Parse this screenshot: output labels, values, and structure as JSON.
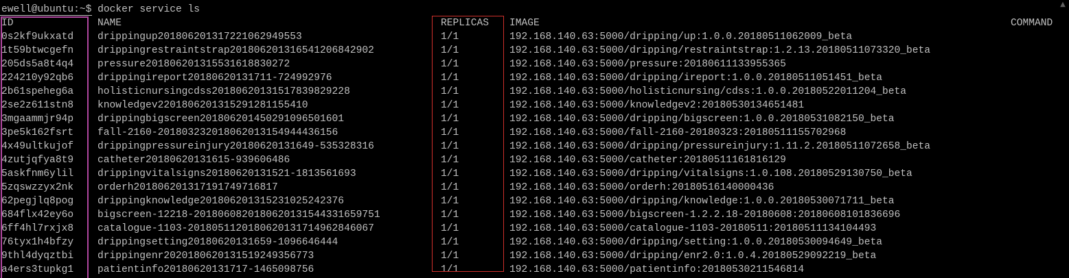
{
  "terminal": {
    "prompt": "ewell@ubuntu:~$ docker service ls",
    "text_color": "#c0c0c0",
    "background": "#000000",
    "highlight_id_color": "#b0479f",
    "highlight_replicas_color": "#d0302b",
    "scrollbar_arrow_icon": "up-arrow-icon",
    "scrollbar_arrow_glyph": "▲"
  },
  "headers": {
    "id": "ID",
    "name": "NAME",
    "replicas": "REPLICAS",
    "image": "IMAGE",
    "command": "COMMAND"
  },
  "rows": [
    {
      "id": "0s2kf9ukxatd",
      "name": "drippingup20180620131722106294955​3",
      "replicas": "1/1",
      "image": "192.168.140.63:5000/dripping/up:1.0.0.20180511062009_beta"
    },
    {
      "id": "1t59btwcgefn",
      "name": "drippingrestraintstrap20180620131654120684290​2",
      "replicas": "1/1",
      "image": "192.168.140.63:5000/dripping/restraintstrap:1.2.13.20180511073320_beta"
    },
    {
      "id": "205ds5a8t4q4",
      "name": "pressure20180620131553161883027​2",
      "replicas": "1/1",
      "image": "192.168.140.63:5000/pressure:20180611133955365"
    },
    {
      "id": "224210y92qb6",
      "name": "drippingireport20180620131711-724992976",
      "replicas": "1/1",
      "image": "192.168.140.63:5000/dripping/ireport:1.0.0.20180511051451_beta"
    },
    {
      "id": "2b61speheg6a",
      "name": "holisticnursingcdss20180620131517839829228",
      "replicas": "1/1",
      "image": "192.168.140.63:5000/holisticnursing/cdss:1.0.0.20180522011204_beta"
    },
    {
      "id": "2se2z611stn8",
      "name": "knowledgev220180620131529128115541​0",
      "replicas": "1/1",
      "image": "192.168.140.63:5000/knowledgev2:20180530134651481"
    },
    {
      "id": "3mgaammjr94p",
      "name": "drippingbigscreen20180620145029109650160​1",
      "replicas": "1/1",
      "image": "192.168.140.63:5000/dripping/bigscreen:1.0.0.20180531082150_beta"
    },
    {
      "id": "3pe5k162fsrt",
      "name": "fall-2160-20180323201806201315494443615​6",
      "replicas": "1/1",
      "image": "192.168.140.63:5000/fall-2160-20180323:20180511155702968"
    },
    {
      "id": "4x49ultkujof",
      "name": "drippingpressureinjury20180620131649-535328316",
      "replicas": "1/1",
      "image": "192.168.140.63:5000/dripping/pressureinjury:1.11.2.20180511072658_beta"
    },
    {
      "id": "4zutjqfya8t9",
      "name": "catheter20180620131615-939606486",
      "replicas": "1/1",
      "image": "192.168.140.63:5000/catheter:20180511161816129"
    },
    {
      "id": "5askfnm6ylil",
      "name": "drippingvitalsigns20180620131521-1813561693",
      "replicas": "1/1",
      "image": "192.168.140.63:5000/dripping/vitalsigns:1.0.108.20180529130750_beta"
    },
    {
      "id": "5zqswzzyx2nk",
      "name": "orderh20180620131719174971681​7",
      "replicas": "1/1",
      "image": "192.168.140.63:5000/orderh:20180516140000436"
    },
    {
      "id": "62pegjlq8pog",
      "name": "drippingknowledge20180620131523102524237​6",
      "replicas": "1/1",
      "image": "192.168.140.63:5000/dripping/knowledge:1.0.0.20180530071711_beta"
    },
    {
      "id": "684flx42ey6o",
      "name": "bigscreen-12218-2018060820180620131544331659751",
      "replicas": "1/1",
      "image": "192.168.140.63:5000/bigscreen-1.2.2.18-20180608:20180608101836696"
    },
    {
      "id": "6ff4hl7rxjx8",
      "name": "catalogue-1103-2018051120180620131714962846067",
      "replicas": "1/1",
      "image": "192.168.140.63:5000/catalogue-1103-20180511:20180511134104493"
    },
    {
      "id": "76tyx1h4bfzy",
      "name": "drippingsetting20180620131659-1096646444",
      "replicas": "1/1",
      "image": "192.168.140.63:5000/dripping/setting:1.0.0.20180530094649_beta"
    },
    {
      "id": "9thl4dyqztbi",
      "name": "drippingenr202018062013151924935677​3",
      "replicas": "1/1",
      "image": "192.168.140.63:5000/dripping/enr2.0:1.0.4.20180529092219_beta"
    },
    {
      "id": "a4ers3tupkg1",
      "name": "patientinfo20180620131717-1465098756",
      "replicas": "1/1",
      "image": "192.168.140.63:5000/patientinfo:20180530211546814"
    }
  ]
}
